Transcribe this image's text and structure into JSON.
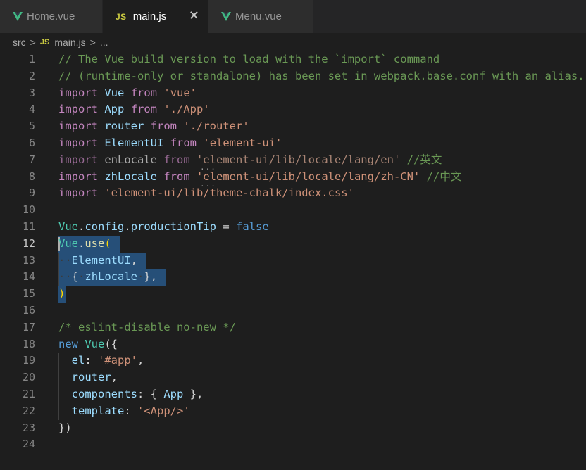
{
  "tabs": [
    {
      "label": "Home.vue",
      "icon": "vue-icon",
      "active": false
    },
    {
      "label": "main.js",
      "icon": "js-icon",
      "active": true
    },
    {
      "label": "Menu.vue",
      "icon": "vue-icon",
      "active": false
    }
  ],
  "js_icon_text": "JS",
  "close_glyph": "✕",
  "breadcrumb": {
    "folder": "src",
    "sep": ">",
    "file": "main.js",
    "more": "..."
  },
  "editor": {
    "current_line": 12,
    "lines": [
      {
        "n": "1",
        "tokens": [
          [
            "cm",
            "// The Vue build version to load with the `import` command"
          ]
        ]
      },
      {
        "n": "2",
        "tokens": [
          [
            "cm",
            "// (runtime-only or standalone) has been set in webpack.base.conf with an alias."
          ]
        ]
      },
      {
        "n": "3",
        "tokens": [
          [
            "kw",
            "import"
          ],
          [
            "pl",
            " "
          ],
          [
            "id",
            "Vue"
          ],
          [
            "pl",
            " "
          ],
          [
            "kw",
            "from"
          ],
          [
            "pl",
            " "
          ],
          [
            "str",
            "'vue'"
          ]
        ]
      },
      {
        "n": "4",
        "tokens": [
          [
            "kw",
            "import"
          ],
          [
            "pl",
            " "
          ],
          [
            "id",
            "App"
          ],
          [
            "pl",
            " "
          ],
          [
            "kw",
            "from"
          ],
          [
            "pl",
            " "
          ],
          [
            "str",
            "'./App'"
          ]
        ]
      },
      {
        "n": "5",
        "tokens": [
          [
            "kw",
            "import"
          ],
          [
            "pl",
            " "
          ],
          [
            "id",
            "router"
          ],
          [
            "pl",
            " "
          ],
          [
            "kw",
            "from"
          ],
          [
            "pl",
            " "
          ],
          [
            "str",
            "'./router'"
          ]
        ]
      },
      {
        "n": "6",
        "tokens": [
          [
            "kw",
            "import"
          ],
          [
            "pl",
            " "
          ],
          [
            "id",
            "ElementUI"
          ],
          [
            "pl",
            " "
          ],
          [
            "kw",
            "from"
          ],
          [
            "pl",
            " "
          ],
          [
            "str",
            "'element-ui'"
          ]
        ]
      },
      {
        "n": "7",
        "tokens": [
          [
            "kw-dim",
            "import"
          ],
          [
            "pl",
            " "
          ],
          [
            "id-dim",
            "enLocale"
          ],
          [
            "pl",
            " "
          ],
          [
            "kw-dim",
            "from"
          ],
          [
            "pl",
            " "
          ],
          [
            "str-dim",
            "'element-ui/lib/locale/lang/en'"
          ],
          [
            "pl",
            " "
          ],
          [
            "cm",
            "//"
          ],
          [
            "cmcn",
            "英文"
          ]
        ]
      },
      {
        "n": "8",
        "tokens": [
          [
            "kw",
            "import"
          ],
          [
            "pl",
            " "
          ],
          [
            "id",
            "zhLocale"
          ],
          [
            "pl",
            " "
          ],
          [
            "kw",
            "from"
          ],
          [
            "pl",
            " "
          ],
          [
            "str",
            "'element-ui/lib/locale/lang/zh-CN'"
          ],
          [
            "pl",
            " "
          ],
          [
            "cm",
            "//"
          ],
          [
            "cmcn",
            "中文"
          ]
        ]
      },
      {
        "n": "9",
        "tokens": [
          [
            "kw",
            "import"
          ],
          [
            "pl",
            " "
          ],
          [
            "str",
            "'element-ui/lib/theme-chalk/index.css'"
          ]
        ]
      },
      {
        "n": "10",
        "tokens": []
      },
      {
        "n": "11",
        "tokens": [
          [
            "cl",
            "Vue"
          ],
          [
            "pl",
            "."
          ],
          [
            "id",
            "config"
          ],
          [
            "pl",
            "."
          ],
          [
            "id",
            "productionTip"
          ],
          [
            "pl",
            " = "
          ],
          [
            "bool",
            "false"
          ]
        ]
      },
      {
        "n": "12",
        "tokens": [
          [
            "cl",
            "Vue"
          ],
          [
            "pl",
            "."
          ],
          [
            "fn",
            "use"
          ],
          [
            "brk",
            "("
          ]
        ]
      },
      {
        "n": "13",
        "tokens": [
          [
            "ws",
            "··"
          ],
          [
            "id",
            "ElementUI"
          ],
          [
            "pl",
            ","
          ]
        ]
      },
      {
        "n": "14",
        "tokens": [
          [
            "ws",
            "··"
          ],
          [
            "pl",
            "{"
          ],
          [
            "ws",
            "·"
          ],
          [
            "id",
            "zhLocale"
          ],
          [
            "ws",
            "·"
          ],
          [
            "pl",
            "},"
          ]
        ]
      },
      {
        "n": "15",
        "tokens": [
          [
            "brk",
            ")"
          ]
        ]
      },
      {
        "n": "16",
        "tokens": []
      },
      {
        "n": "17",
        "tokens": [
          [
            "cm",
            "/* eslint-disable no-new */"
          ]
        ]
      },
      {
        "n": "18",
        "tokens": [
          [
            "bool",
            "new"
          ],
          [
            "pl",
            " "
          ],
          [
            "cl",
            "Vue"
          ],
          [
            "pl",
            "({"
          ]
        ]
      },
      {
        "n": "19",
        "tokens": [
          [
            "pl",
            "  "
          ],
          [
            "id",
            "el"
          ],
          [
            "pl",
            ": "
          ],
          [
            "str",
            "'#app'"
          ],
          [
            "pl",
            ","
          ]
        ]
      },
      {
        "n": "20",
        "tokens": [
          [
            "pl",
            "  "
          ],
          [
            "id",
            "router"
          ],
          [
            "pl",
            ","
          ]
        ]
      },
      {
        "n": "21",
        "tokens": [
          [
            "pl",
            "  "
          ],
          [
            "id",
            "components"
          ],
          [
            "pl",
            ": { "
          ],
          [
            "id",
            "App"
          ],
          [
            "pl",
            " },"
          ]
        ]
      },
      {
        "n": "22",
        "tokens": [
          [
            "pl",
            "  "
          ],
          [
            "id",
            "template"
          ],
          [
            "pl",
            ": "
          ],
          [
            "str",
            "'<App/>'"
          ]
        ]
      },
      {
        "n": "23",
        "tokens": [
          [
            "pl",
            "})"
          ]
        ]
      },
      {
        "n": "24",
        "tokens": []
      }
    ]
  },
  "colors": {
    "background": "#1e1e1e",
    "tab_bar": "#252526",
    "selection": "#264f78",
    "vue_green": "#41b883",
    "js_yellow": "#cbcb41"
  }
}
